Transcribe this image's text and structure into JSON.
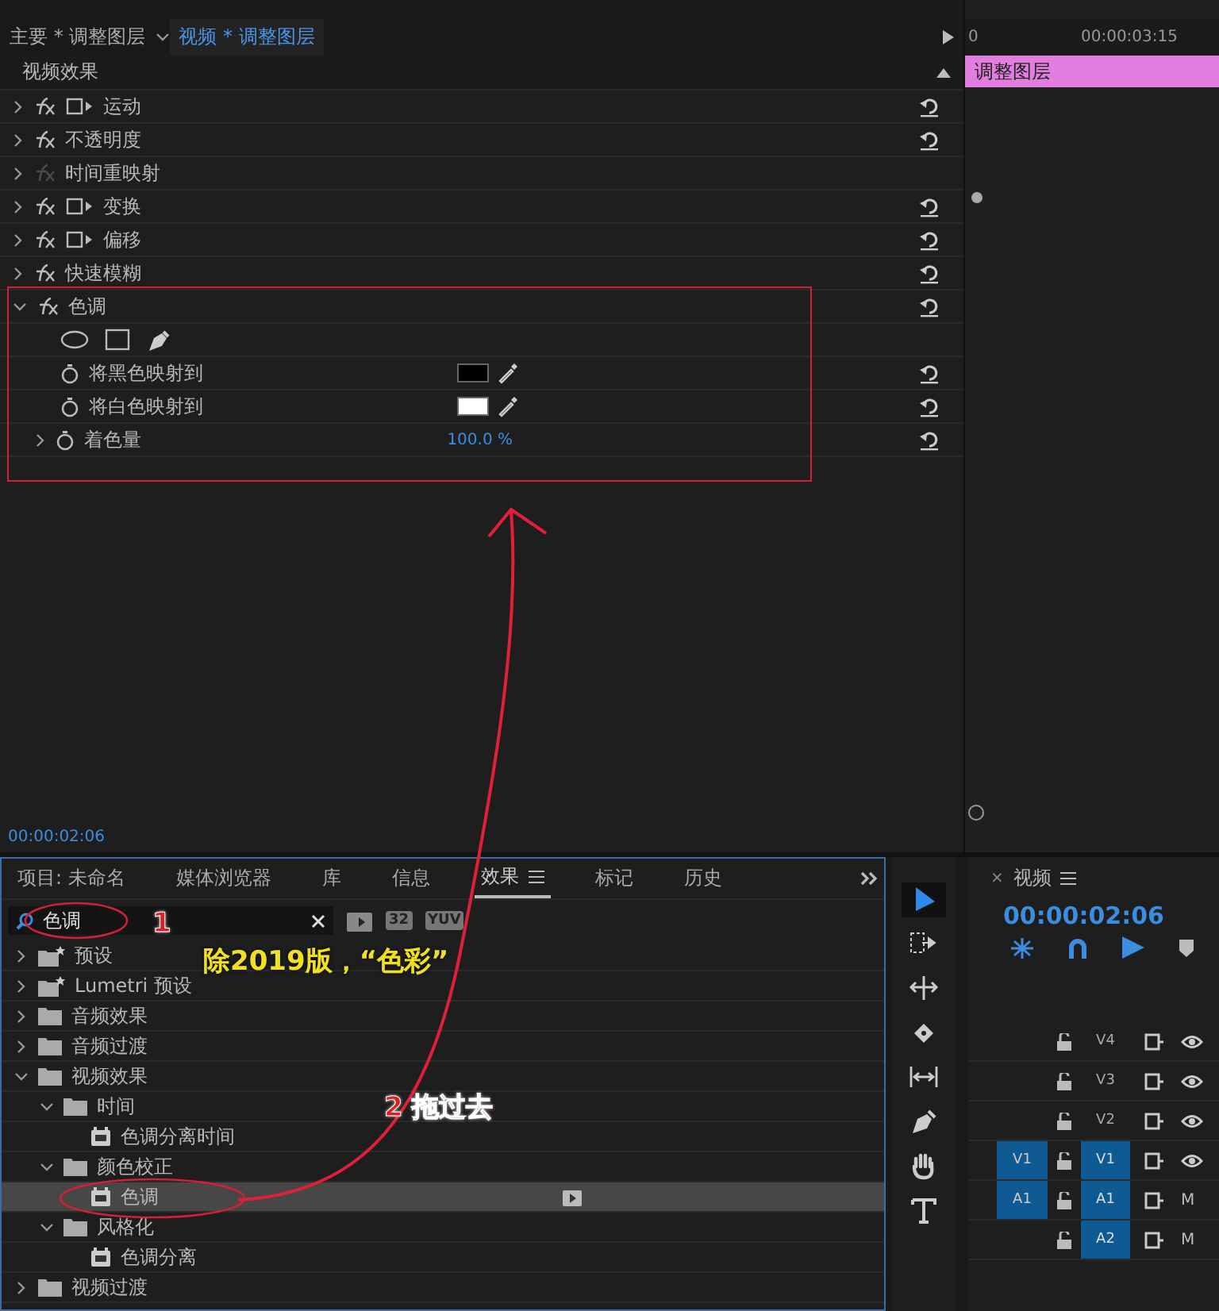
{
  "effect_controls": {
    "tabs": [
      {
        "label": "主要 * 调整图层",
        "selected": false
      },
      {
        "label": "视频 * 调整图层",
        "selected": true
      }
    ],
    "section": "视频效果",
    "effects": [
      {
        "name": "运动",
        "fx_enabled": true,
        "transform_icon": true,
        "expanded": false,
        "resettable": true
      },
      {
        "name": "不透明度",
        "fx_enabled": true,
        "transform_icon": false,
        "expanded": false,
        "resettable": true
      },
      {
        "name": "时间重映射",
        "fx_enabled": false,
        "transform_icon": false,
        "expanded": false,
        "resettable": false
      },
      {
        "name": "变换",
        "fx_enabled": true,
        "transform_icon": true,
        "expanded": false,
        "resettable": true
      },
      {
        "name": "偏移",
        "fx_enabled": true,
        "transform_icon": true,
        "expanded": false,
        "resettable": true
      },
      {
        "name": "快速模糊",
        "fx_enabled": true,
        "transform_icon": false,
        "expanded": false,
        "resettable": true
      },
      {
        "name": "色调",
        "fx_enabled": true,
        "transform_icon": false,
        "expanded": true,
        "resettable": true,
        "properties": [
          {
            "name": "将黑色映射到",
            "kind": "color",
            "color": "#000000"
          },
          {
            "name": "将白色映射到",
            "kind": "color",
            "color": "#ffffff"
          },
          {
            "name": "着色量",
            "kind": "number",
            "value": "100.0 %"
          }
        ]
      }
    ],
    "timecode": "00:00:02:06"
  },
  "mini_timeline": {
    "ruler": [
      "0",
      "00:00:03:15"
    ],
    "clip": "调整图层"
  },
  "effects_panel": {
    "tabs": [
      {
        "label": "项目: 未命名",
        "selected": false,
        "menu": false
      },
      {
        "label": "媒体浏览器",
        "selected": false,
        "menu": false
      },
      {
        "label": "库",
        "selected": false,
        "menu": false
      },
      {
        "label": "信息",
        "selected": false,
        "menu": false
      },
      {
        "label": "效果",
        "selected": true,
        "menu": true
      },
      {
        "label": "标记",
        "selected": false,
        "menu": false
      },
      {
        "label": "历史",
        "selected": false,
        "menu": false
      }
    ],
    "search": {
      "value": "色调"
    },
    "filter_badges": [
      "32",
      "YUV"
    ],
    "tree": [
      {
        "label": "预设",
        "kind": "preset_folder",
        "expanded": false,
        "selected": false
      },
      {
        "label": "Lumetri 预设",
        "kind": "preset_folder",
        "expanded": false,
        "selected": false
      },
      {
        "label": "音频效果",
        "kind": "folder",
        "expanded": false,
        "selected": false
      },
      {
        "label": "音频过渡",
        "kind": "folder",
        "expanded": false,
        "selected": false
      },
      {
        "label": "视频效果",
        "kind": "folder",
        "expanded": true,
        "selected": false,
        "children": [
          {
            "label": "时间",
            "kind": "folder",
            "expanded": true,
            "selected": false,
            "children": [
              {
                "label": "色调分离时间",
                "kind": "effect",
                "selected": false,
                "accelerated": false
              }
            ]
          },
          {
            "label": "颜色校正",
            "kind": "folder",
            "expanded": true,
            "selected": false,
            "children": [
              {
                "label": "色调",
                "kind": "effect",
                "selected": true,
                "accelerated": true
              }
            ]
          },
          {
            "label": "风格化",
            "kind": "folder",
            "expanded": true,
            "selected": false,
            "children": [
              {
                "label": "色调分离",
                "kind": "effect",
                "selected": false,
                "accelerated": false
              }
            ]
          }
        ]
      },
      {
        "label": "视频过渡",
        "kind": "folder",
        "expanded": false,
        "selected": false
      }
    ]
  },
  "tools": [
    {
      "kind": "selection",
      "selected": true
    },
    {
      "kind": "track_select",
      "selected": false
    },
    {
      "kind": "ripple",
      "selected": false
    },
    {
      "kind": "razor",
      "selected": false
    },
    {
      "kind": "slip",
      "selected": false
    },
    {
      "kind": "pen",
      "selected": false
    },
    {
      "kind": "hand",
      "selected": false
    },
    {
      "kind": "type",
      "selected": false
    }
  ],
  "timeline": {
    "close": "×",
    "title": "视频",
    "timecode": "00:00:02:06",
    "tracks": [
      {
        "kind": "video",
        "name": "V4",
        "targeted": false
      },
      {
        "kind": "video",
        "name": "V3",
        "targeted": false
      },
      {
        "kind": "video",
        "name": "V2",
        "targeted": false
      },
      {
        "kind": "video",
        "name": "V1",
        "source": "V1",
        "targeted": true
      },
      {
        "kind": "audio",
        "name": "A1",
        "source": "A1",
        "targeted": true,
        "mute": "M"
      },
      {
        "kind": "audio",
        "name": "A2",
        "targeted": true,
        "mute": "M"
      }
    ]
  },
  "annotations": [
    {
      "kind": "step",
      "text": "1"
    },
    {
      "kind": "note",
      "text": "除2019版，“色彩”"
    },
    {
      "kind": "step",
      "text": "2  拖过去"
    }
  ]
}
